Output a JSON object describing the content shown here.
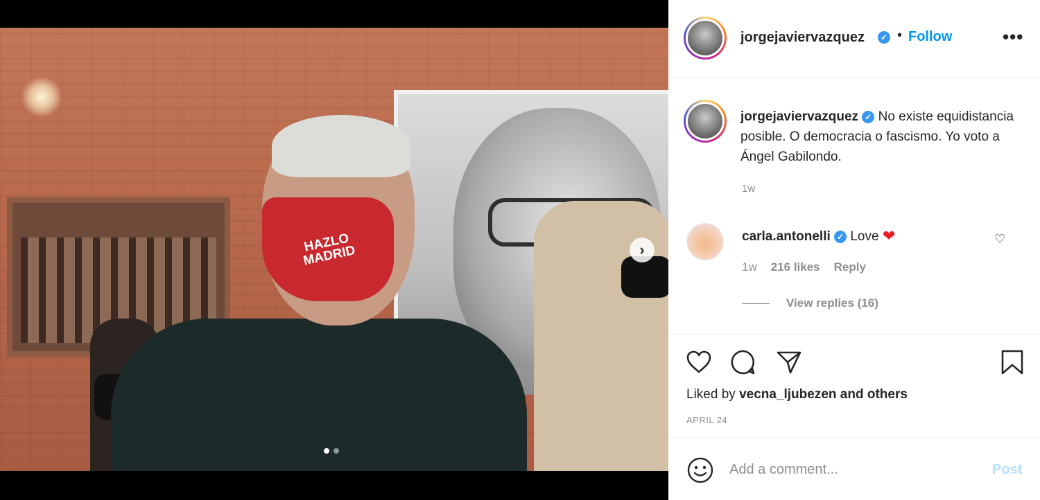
{
  "post": {
    "username": "jorgejaviervazquez",
    "separator": "•",
    "follow_label": "Follow",
    "more_label": "•••",
    "verified_mark": "✓",
    "caption_text": "No existe equidistancia posible. O democracia o fascismo. Yo voto a Ángel Gabilondo.",
    "caption_time": "1w",
    "media": {
      "mask_text": "HAZLO MADRID",
      "next_label": "›",
      "slide_count": 2,
      "active_slide": 1
    }
  },
  "comment": {
    "username": "carla.antonelli",
    "text": "Love",
    "emoji": "❤",
    "like_icon": "♡",
    "time": "1w",
    "likes": "216 likes",
    "reply_label": "Reply",
    "view_replies": "View replies (16)"
  },
  "actions": {
    "icons": [
      "heart-icon",
      "comment-icon",
      "share-icon",
      "bookmark-icon"
    ],
    "liked_by_prefix": "Liked by",
    "liked_by_user": "vecna_ljubezen",
    "liked_by_suffix": "and others",
    "date": "APRIL 24"
  },
  "add_comment": {
    "placeholder": "Add a comment...",
    "post_label": "Post"
  },
  "colors": {
    "link_blue": "#0095f6",
    "post_disabled": "#b2dffc",
    "verified_blue": "#3897f0",
    "secondary_text": "#8e8e8e"
  }
}
